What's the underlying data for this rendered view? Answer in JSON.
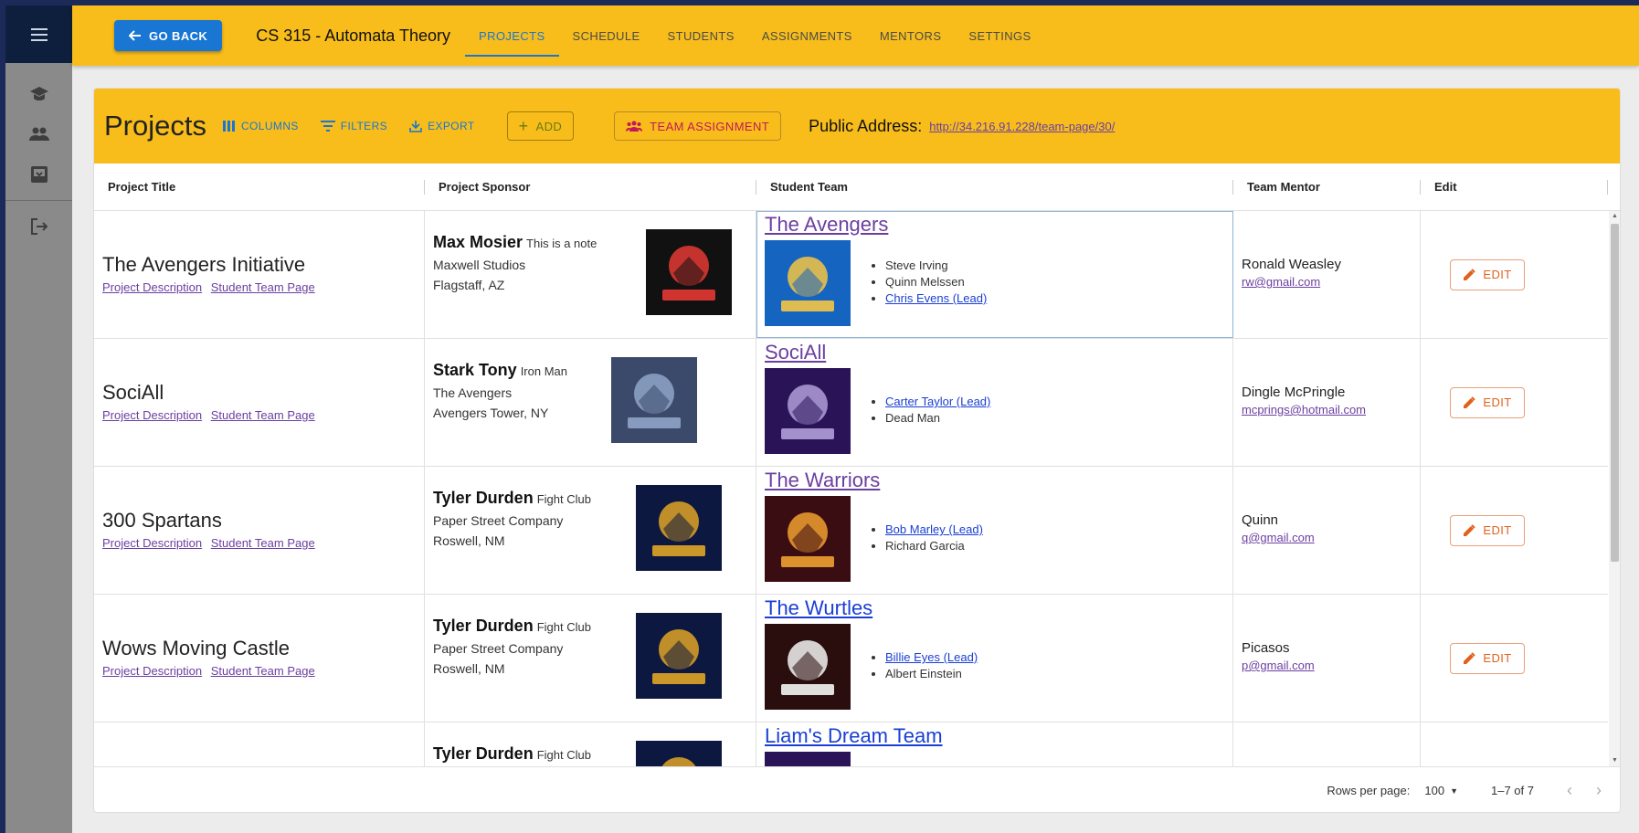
{
  "topbar": {
    "back_label": "GO BACK",
    "course_title": "CS 315 - Automata Theory",
    "tabs": [
      {
        "label": "PROJECTS",
        "active": true
      },
      {
        "label": "SCHEDULE"
      },
      {
        "label": "STUDENTS"
      },
      {
        "label": "ASSIGNMENTS"
      },
      {
        "label": "MENTORS"
      },
      {
        "label": "SETTINGS"
      }
    ]
  },
  "rail": {
    "icons": [
      "menu-icon",
      "school-icon",
      "people-icon",
      "inbox-icon",
      "logout-icon"
    ]
  },
  "card": {
    "title": "Projects",
    "toolbar": {
      "columns": "COLUMNS",
      "filters": "FILTERS",
      "export": "EXPORT",
      "add": "ADD",
      "team_assignment": "TEAM ASSIGNMENT"
    },
    "public_address_label": "Public Address:",
    "public_address_url": "http://34.216.91.228/team-page/30/"
  },
  "grid": {
    "headers": [
      "Project Title",
      "Project Sponsor",
      "Student Team",
      "Team Mentor",
      "Edit"
    ],
    "desc_link": "Project Description",
    "team_link": "Student Team Page",
    "edit_label": "EDIT",
    "rows": [
      {
        "title": "The Avengers Initiative",
        "sponsor": {
          "name": "Max Mosier",
          "note": "This is a note",
          "company": "Maxwell Studios",
          "location": "Flagstaff, AZ",
          "logo": "panther-logo"
        },
        "team": {
          "name": "The Avengers",
          "color": "#6b3fa0",
          "logo": "warrior-logo",
          "members": [
            {
              "name": "Steve Irving",
              "lead": false
            },
            {
              "name": "Quinn Melssen",
              "lead": false
            },
            {
              "name": "Chris Evens (Lead)",
              "lead": true
            }
          ]
        },
        "mentor": {
          "name": "Ronald Weasley",
          "email": "rw@gmail.com"
        }
      },
      {
        "title": "SociAll",
        "sponsor": {
          "name": "Stark Tony",
          "note": "Iron Man",
          "company": "The Avengers",
          "location": "Avengers Tower, NY",
          "logo": "avengers-photo"
        },
        "team": {
          "name": "SociAll",
          "color": "#6b3fa0",
          "logo": "warriors-logo",
          "members": [
            {
              "name": "Carter Taylor (Lead)",
              "lead": true
            },
            {
              "name": "Dead Man",
              "lead": false
            }
          ]
        },
        "mentor": {
          "name": "Dingle McPringle",
          "email": "mcprings@hotmail.com"
        }
      },
      {
        "title": "300 Spartans",
        "sponsor": {
          "name": "Tyler Durden",
          "note": "Fight Club",
          "company": "Paper Street Company",
          "location": "Roswell, NM",
          "logo": "wolves-logo"
        },
        "team": {
          "name": "The Warriors",
          "color": "#6b3fa0",
          "logo": "lion-logo",
          "members": [
            {
              "name": "Bob Marley (Lead)",
              "lead": true
            },
            {
              "name": "Richard Garcia",
              "lead": false
            }
          ]
        },
        "mentor": {
          "name": "Quinn",
          "email": "q@gmail.com"
        }
      },
      {
        "title": "Wows Moving Castle",
        "sponsor": {
          "name": "Tyler Durden",
          "note": "Fight Club",
          "company": "Paper Street Company",
          "location": "Roswell, NM",
          "logo": "wolves-logo"
        },
        "team": {
          "name": "The Wurtles",
          "color": "#1a3fd4",
          "logo": "pumas-logo",
          "members": [
            {
              "name": "Billie Eyes (Lead)",
              "lead": true
            },
            {
              "name": "Albert Einstein",
              "lead": false
            }
          ]
        },
        "mentor": {
          "name": "Picasos",
          "email": "p@gmail.com"
        }
      },
      {
        "title": "",
        "sponsor": {
          "name": "Tyler Durden",
          "note": "Fight Club",
          "company": "",
          "location": "",
          "logo": "wolves-logo"
        },
        "team": {
          "name": "Liam's Dream Team",
          "color": "#1a3fd4",
          "logo": "purple-logo",
          "members": []
        },
        "mentor": {
          "name": "",
          "email": ""
        }
      }
    ]
  },
  "footer": {
    "rows_per_page_label": "Rows per page:",
    "rows_per_page_value": "100",
    "range": "1–7 of 7"
  }
}
